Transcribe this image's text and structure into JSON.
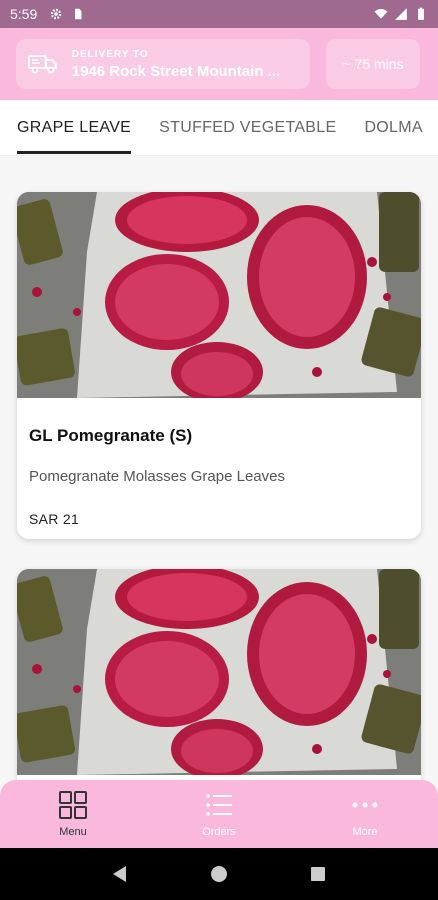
{
  "status_bar": {
    "time": "5:59",
    "icons": [
      "gear-icon",
      "sim-icon",
      "wifi-icon",
      "signal-icon",
      "battery-icon"
    ]
  },
  "header": {
    "delivery_label": "DELIVERY TO",
    "delivery_address": "1946 Rock Street Mountain ...",
    "eta": "~ 75 mins",
    "accent_color": "#f9b8dc"
  },
  "tabs": [
    {
      "label": "GRAPE LEAVE",
      "active": true
    },
    {
      "label": "STUFFED VEGETABLE",
      "active": false
    },
    {
      "label": "DOLMA",
      "active": false
    }
  ],
  "products": [
    {
      "title": "GL Pomegranate (S)",
      "description": "Pomegranate Molasses Grape Leaves",
      "price": "SAR 21",
      "image": "pomegranate-grape-leaves-photo"
    },
    {
      "title": "",
      "description": "",
      "price": "",
      "image": "pomegranate-grape-leaves-photo"
    }
  ],
  "bottom_nav": [
    {
      "label": "Menu",
      "icon": "grid-icon",
      "active": true
    },
    {
      "label": "Orders",
      "icon": "list-icon",
      "active": false
    },
    {
      "label": "More",
      "icon": "more-dots-icon",
      "active": false
    }
  ]
}
